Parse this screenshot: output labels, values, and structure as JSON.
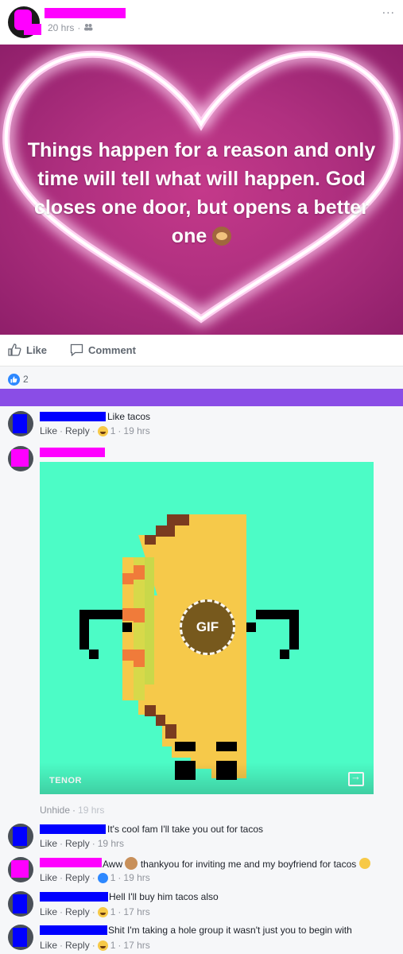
{
  "post": {
    "time": "20 hrs",
    "privacy_icon": "friends-icon",
    "more": "...",
    "quote_text": "Things happen for a reason and only time will tell what will happen. God closes one door, but opens a better one"
  },
  "actions": {
    "like_label": "Like",
    "comment_label": "Comment"
  },
  "reactions": {
    "count": "2"
  },
  "comments": [
    {
      "text": "Like tacos",
      "like": "Like",
      "reply": "Reply",
      "react_count": "1",
      "time": "19 hrs"
    },
    {
      "gif_provider": "TENOR",
      "gif_badge": "GIF",
      "unhide": "Unhide",
      "time": "19 hrs"
    },
    {
      "text": "It's cool fam I'll take you out for tacos",
      "like": "Like",
      "reply": "Reply",
      "time": "19 hrs"
    },
    {
      "text_a": "Aww",
      "text_b": "thankyou for inviting me and my boyfriend for tacos",
      "like": "Like",
      "reply": "Reply",
      "react_count": "1",
      "time": "19 hrs"
    },
    {
      "text": "Hell I'll buy him tacos also",
      "like": "Like",
      "reply": "Reply",
      "react_count": "1",
      "time": "17 hrs"
    },
    {
      "text": "Shit I'm taking a hole group it wasn't just you to begin with",
      "like": "Like",
      "reply": "Reply",
      "react_count": "1",
      "time": "17 hrs"
    }
  ],
  "colors": {
    "quote_bg": "#b03080",
    "gif_bg": "#4cfcc6",
    "divider": "#8a4de6",
    "link": "#4b4f56",
    "meta": "#90949c"
  }
}
